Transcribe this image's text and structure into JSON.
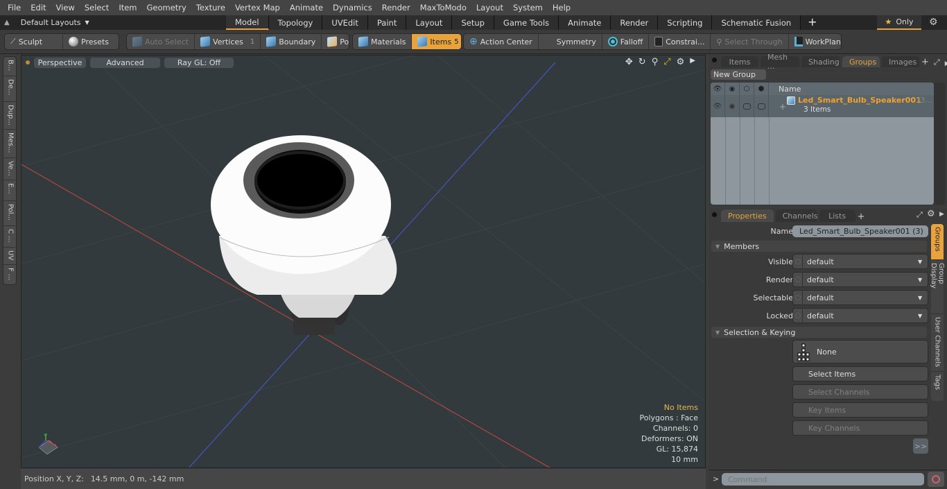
{
  "menubar": {
    "items": [
      "File",
      "Edit",
      "View",
      "Select",
      "Item",
      "Geometry",
      "Texture",
      "Vertex Map",
      "Animate",
      "Dynamics",
      "Render",
      "MaxToModo",
      "Layout",
      "System",
      "Help"
    ]
  },
  "layoutbar": {
    "layout_select": "Default Layouts",
    "tabs": [
      {
        "label": "Model",
        "active": true
      },
      {
        "label": "Topology"
      },
      {
        "label": "UVEdit"
      },
      {
        "label": "Paint"
      },
      {
        "label": "Layout"
      },
      {
        "label": "Setup"
      },
      {
        "label": "Game Tools"
      },
      {
        "label": "Animate"
      },
      {
        "label": "Render"
      },
      {
        "label": "Scripting"
      },
      {
        "label": "Schematic Fusion"
      }
    ],
    "add_label": "+",
    "only_label": "Only",
    "only_icon": "star-icon"
  },
  "toolbar": {
    "sculpt": "Sculpt",
    "presets": "Presets",
    "auto_select": "Auto Select",
    "vertices": "Vertices",
    "vertices_count": "1",
    "boundary": "Boundary",
    "polygons": "Polygons",
    "materials": "Materials",
    "items": "Items",
    "items_count": "5",
    "action_center": "Action Center",
    "symmetry": "Symmetry",
    "falloff": "Falloff",
    "constraints": "Constrai...",
    "select_through": "Select Through",
    "workplane": "WorkPlane"
  },
  "left_tabs": [
    "B...",
    "De...",
    "Dup...",
    "Mes...",
    "Ve...",
    "E...",
    "Pol...",
    "C ...",
    "UV",
    "F ..."
  ],
  "viewport": {
    "view_mode": "Perspective",
    "shading": "Advanced",
    "raygl": "Ray GL: Off",
    "info": {
      "selection": "No Items",
      "polygons": "Polygons : Face",
      "channels": "Channels: 0",
      "deformers": "Deformers: ON",
      "gl": "GL: 15,874",
      "scale": "10 mm"
    },
    "axis_colors": {
      "x": "#d04040",
      "y": "#40b040",
      "z": "#4050d0"
    }
  },
  "statusbar": {
    "position_label": "Position X, Y, Z:",
    "position_value": "14.5 mm, 0 m, -142 mm"
  },
  "groups_panel": {
    "tabs": [
      {
        "label": "Items"
      },
      {
        "label": "Mesh ..."
      },
      {
        "label": "Shading"
      },
      {
        "label": "Groups",
        "active": true
      },
      {
        "label": "Images"
      }
    ],
    "new_group": "New Group",
    "name_header": "Name",
    "group": {
      "name": "Led_Smart_Bulb_Speaker001",
      "suffix": "(3...",
      "sub": "3 Items"
    }
  },
  "properties_panel": {
    "tabs": [
      {
        "label": "Properties",
        "active": true
      },
      {
        "label": "Channels"
      },
      {
        "label": "Lists"
      }
    ],
    "name_label": "Name",
    "name_value": "Led_Smart_Bulb_Speaker001 (3)",
    "members_section": "Members",
    "fields": [
      {
        "label": "Visible",
        "value": "default"
      },
      {
        "label": "Render",
        "value": "default"
      },
      {
        "label": "Selectable",
        "value": "default"
      },
      {
        "label": "Locked",
        "value": "default"
      }
    ],
    "selection_section": "Selection & Keying",
    "none_label": "None",
    "buttons": [
      {
        "label": "Select Items",
        "enabled": true
      },
      {
        "label": "Select Channels",
        "enabled": false
      },
      {
        "label": "Key Items",
        "enabled": false
      },
      {
        "label": "Key Channels",
        "enabled": false
      }
    ],
    "more": ">>",
    "side_tabs": [
      {
        "label": "Groups",
        "active": true
      },
      {
        "label": "Group Display"
      },
      {
        "label": "User Channels"
      },
      {
        "label": "Tags"
      }
    ]
  },
  "command": {
    "prompt": ">",
    "placeholder": "Command"
  },
  "colors": {
    "accent": "#e8a33c",
    "group_name": "#f0a030"
  }
}
